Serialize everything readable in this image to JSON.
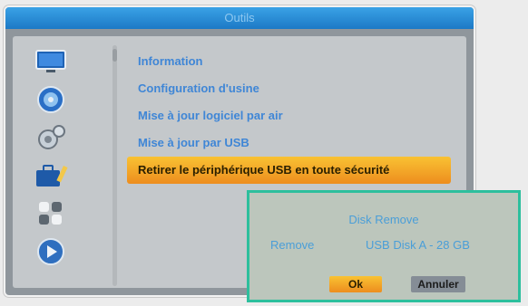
{
  "window": {
    "title": "Outils"
  },
  "sidebar": {
    "icons": [
      {
        "name": "tv-monitor-icon"
      },
      {
        "name": "disc-icon"
      },
      {
        "name": "gear-icon"
      },
      {
        "name": "toolbox-icon"
      },
      {
        "name": "puzzle-icon"
      },
      {
        "name": "media-player-icon"
      }
    ]
  },
  "menu": {
    "items": [
      {
        "label": "Information"
      },
      {
        "label": "Configuration d'usine"
      },
      {
        "label": "Mise à jour logiciel par air"
      },
      {
        "label": "Mise à jour par USB"
      },
      {
        "label": "Retirer le périphérique USB en toute sécurité"
      }
    ],
    "selected_index": 4
  },
  "dialog": {
    "title": "Disk Remove",
    "field_label": "Remove",
    "field_value": "USB Disk A - 28 GB",
    "ok_label": "Ok",
    "cancel_label": "Annuler"
  },
  "colors": {
    "title_bar": "#1c79c6",
    "menu_text": "#3f86d6",
    "highlight": "#f5a623",
    "dialog_border": "#2dbf9d"
  }
}
